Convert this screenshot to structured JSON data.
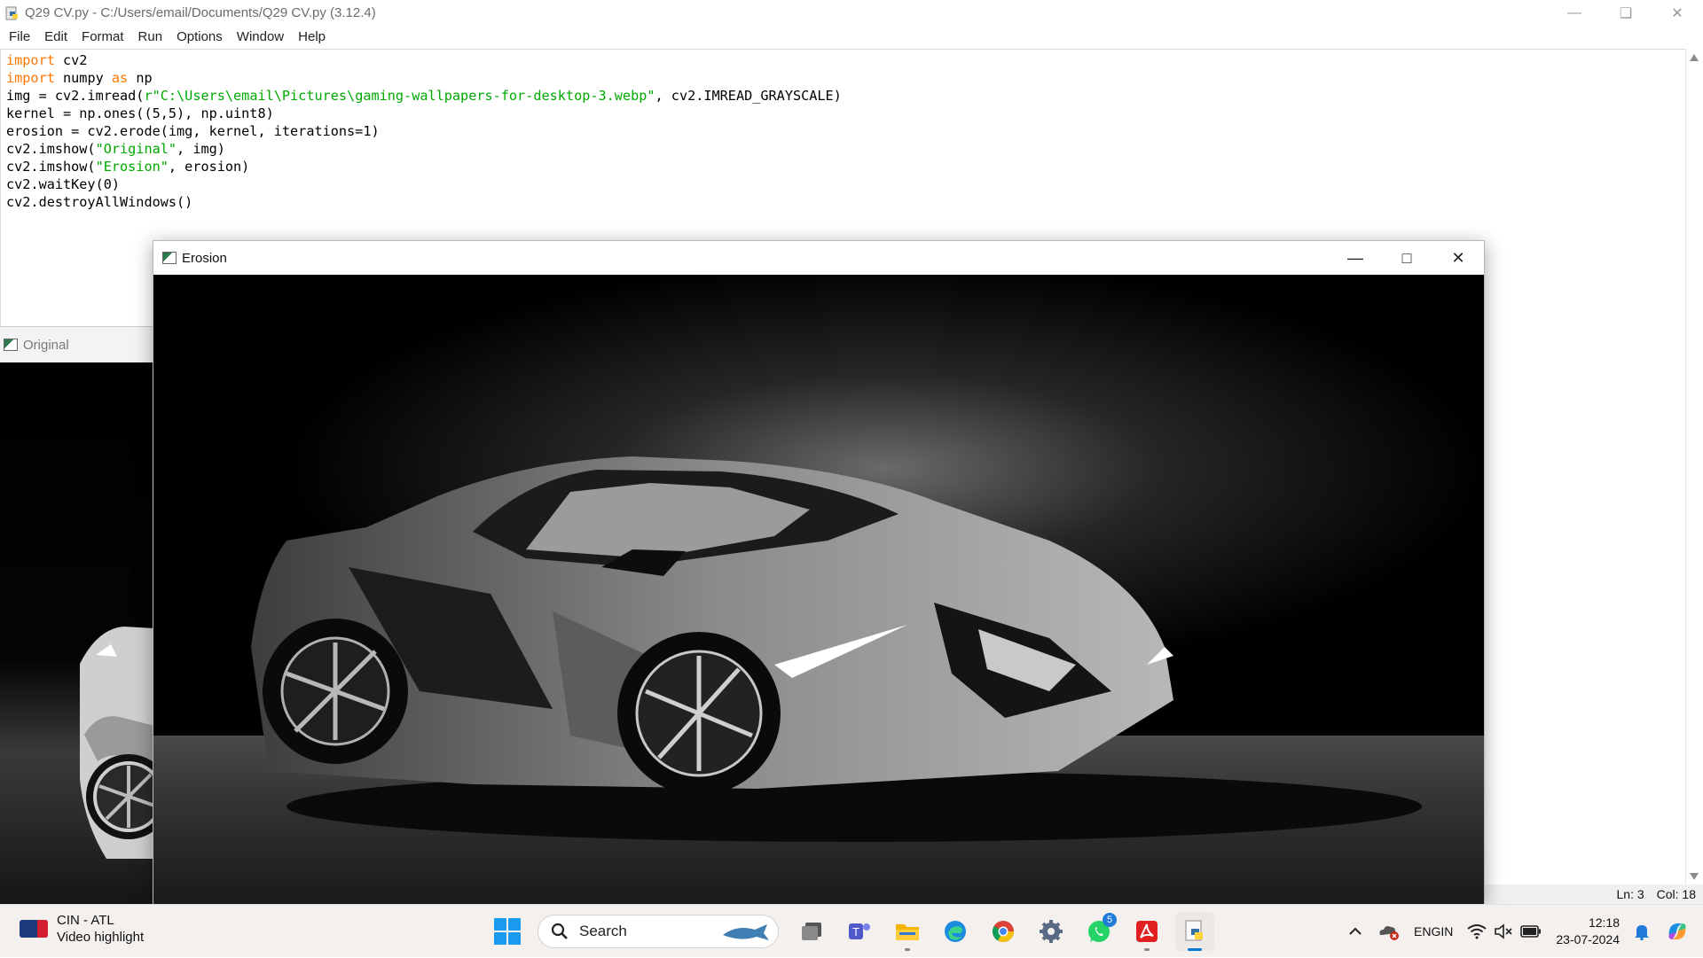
{
  "idle": {
    "title": "Q29 CV.py - C:/Users/email/Documents/Q29 CV.py (3.12.4)",
    "menu": [
      "File",
      "Edit",
      "Format",
      "Run",
      "Options",
      "Window",
      "Help"
    ],
    "code": [
      [
        {
          "t": "import",
          "c": "kw"
        },
        {
          "t": " cv2",
          "c": ""
        }
      ],
      [
        {
          "t": "import",
          "c": "kw"
        },
        {
          "t": " numpy ",
          "c": ""
        },
        {
          "t": "as",
          "c": "kw"
        },
        {
          "t": " np",
          "c": ""
        }
      ],
      [
        {
          "t": "img = cv2.imread(",
          "c": ""
        },
        {
          "t": "r\"C:\\Users\\email\\Pictures\\gaming-wallpapers-for-desktop-3.webp\"",
          "c": "str"
        },
        {
          "t": ", cv2.IMREAD_GRAYSCALE)",
          "c": ""
        }
      ],
      [
        {
          "t": "kernel = np.ones((5,5), np.uint8)",
          "c": ""
        }
      ],
      [
        {
          "t": "erosion = cv2.erode(img, kernel, iterations=1)",
          "c": ""
        }
      ],
      [
        {
          "t": "cv2.imshow(",
          "c": ""
        },
        {
          "t": "\"Original\"",
          "c": "str"
        },
        {
          "t": ", img)",
          "c": ""
        }
      ],
      [
        {
          "t": "cv2.imshow(",
          "c": ""
        },
        {
          "t": "\"Erosion\"",
          "c": "str"
        },
        {
          "t": ", erosion)",
          "c": ""
        }
      ],
      [
        {
          "t": "cv2.waitKey(0)",
          "c": ""
        }
      ],
      [
        {
          "t": "cv2.destroyAllWindows()",
          "c": ""
        }
      ]
    ],
    "status": {
      "line": "Ln: 3",
      "col": "Col: 18"
    }
  },
  "windows": {
    "original_title": "Original",
    "erosion_title": "Erosion"
  },
  "taskbar": {
    "widget": {
      "line1": "CIN - ATL",
      "line2": "Video highlight"
    },
    "search_label": "Search",
    "whatsapp_badge": "5",
    "lang": {
      "line1": "ENG",
      "line2": "IN"
    },
    "clock": {
      "time": "12:18",
      "date": "23-07-2024"
    },
    "icons": [
      "windows-start-icon",
      "task-view-icon",
      "teams-icon",
      "file-explorer-icon",
      "edge-icon",
      "chrome-icon",
      "settings-icon",
      "whatsapp-icon",
      "acrobat-icon",
      "idle-python-icon"
    ]
  },
  "colors": {
    "keyword": "#ff7700",
    "string": "#00aa00",
    "accent": "#0078d4"
  }
}
